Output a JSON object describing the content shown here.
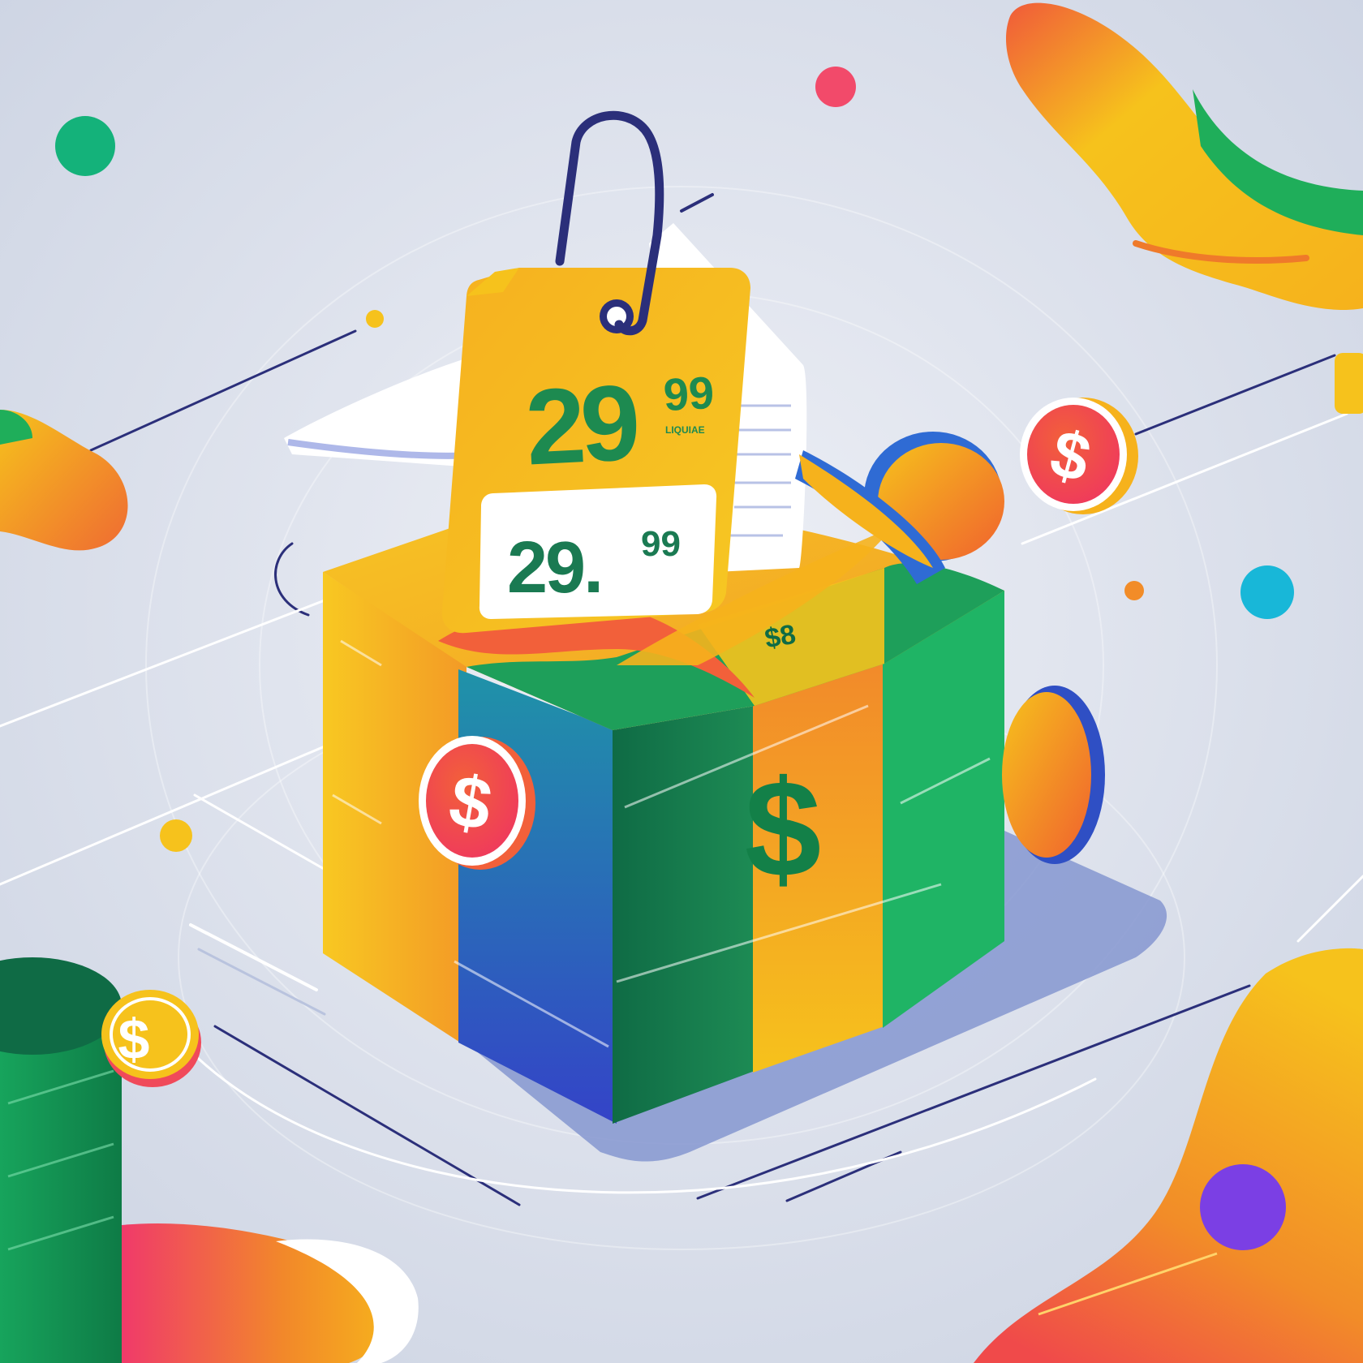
{
  "tag": {
    "main_price": "29",
    "main_cents": "99",
    "small_text": "LIQUIAE",
    "label_price": "29.",
    "label_cents": "99"
  },
  "box": {
    "top_text": "$8"
  },
  "symbols": {
    "currency": "$"
  },
  "colors": {
    "background": "#dfe3ee",
    "yellow": "#f6c21c",
    "orange": "#f28c28",
    "green": "#22a35a",
    "dark_green": "#0f6b45",
    "blue": "#2f5fc4",
    "navy": "#2b2f7a",
    "red": "#f04a5a",
    "teal": "#18b7d8",
    "purple": "#7b3fe4"
  },
  "icons": [
    "dollar-coin-icon",
    "price-tag-icon",
    "paperclip-icon",
    "gift-box-icon"
  ]
}
